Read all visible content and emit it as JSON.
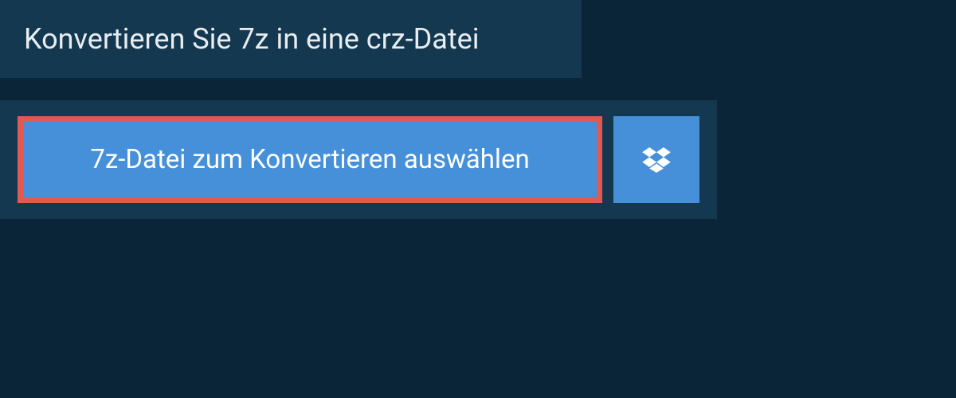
{
  "header": {
    "title": "Konvertieren Sie 7z in eine crz-Datei"
  },
  "actions": {
    "select_file_label": "7z-Datei zum Konvertieren auswählen",
    "dropbox_icon": "dropbox"
  },
  "colors": {
    "background": "#0a2438",
    "panel": "#143850",
    "button": "#4590d9",
    "highlight_border": "#e05a52",
    "text_light": "#e8edf1",
    "text_white": "#ffffff"
  }
}
